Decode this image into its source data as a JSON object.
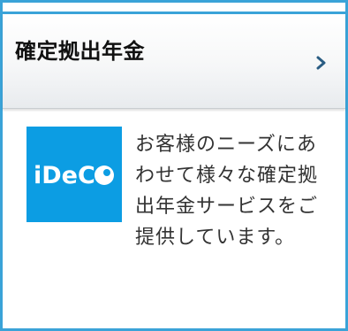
{
  "header": {
    "title": "確定拠出年金",
    "chevron_icon": "chevron-right-icon",
    "chevron_color": "#2a5d83"
  },
  "logo": {
    "text": "iDeCo",
    "background": "#0c9de3"
  },
  "description": "お客様のニーズにあわせて様々な確定拠出年金サービスをご提供しています。",
  "colors": {
    "accent_border": "#3aa3d8",
    "text": "#333333"
  }
}
